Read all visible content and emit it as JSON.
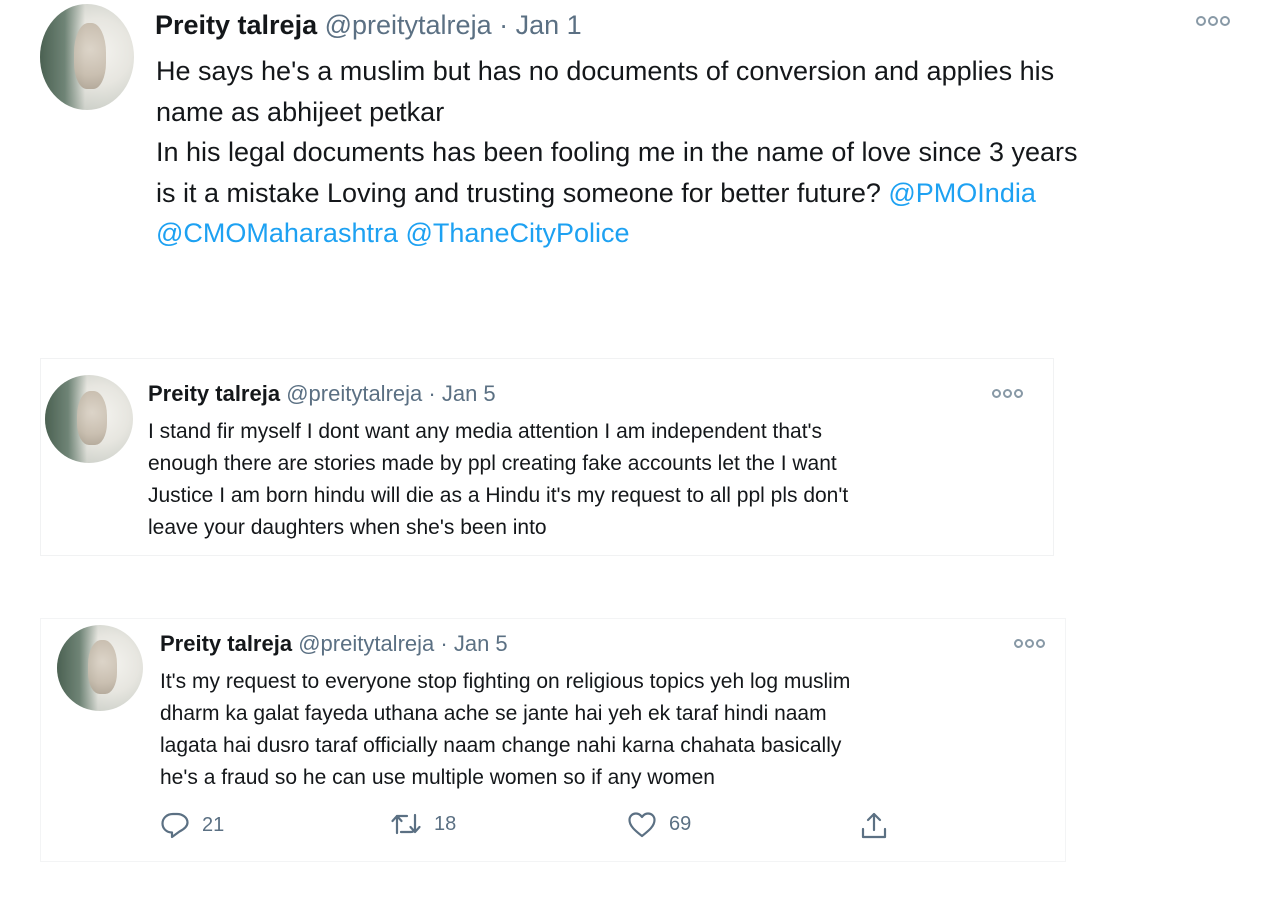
{
  "tweets": [
    {
      "name": "Preity talreja",
      "handle": "@preitytalreja",
      "separator": "·",
      "date": "Jan 1",
      "lines": [
        [
          {
            "text": "He says he's a muslim but has no documents of conversion and applies his"
          }
        ],
        [
          {
            "text": "name as abhijeet petkar"
          }
        ],
        [
          {
            "text": "In his legal documents has been fooling me in the name of love since 3 years"
          }
        ],
        [
          {
            "text": "is it a mistake Loving and trusting someone for better future? "
          },
          {
            "text": "@PMOIndia",
            "mention": true
          }
        ],
        [
          {
            "text": "@CMOMaharashtra",
            "mention": true
          },
          {
            "text": " "
          },
          {
            "text": "@ThaneCityPolice",
            "mention": true
          }
        ]
      ]
    },
    {
      "name": "Preity talreja",
      "handle": "@preitytalreja",
      "separator": "·",
      "date": "Jan 5",
      "lines": [
        [
          {
            "text": "I stand fir myself I dont want any media attention I am independent that's"
          }
        ],
        [
          {
            "text": "enough there are stories made by ppl creating fake accounts let the I want"
          }
        ],
        [
          {
            "text": "Justice I am born hindu will die as a Hindu it's my request to all ppl pls don't"
          }
        ],
        [
          {
            "text": "leave your daughters when she's been into"
          }
        ]
      ]
    },
    {
      "name": "Preity talreja",
      "handle": "@preitytalreja",
      "separator": "·",
      "date": "Jan 5",
      "lines": [
        [
          {
            "text": "It's my request to everyone stop fighting on religious topics yeh log muslim"
          }
        ],
        [
          {
            "text": "dharm ka galat fayeda uthana ache se jante hai yeh ek taraf hindi naam"
          }
        ],
        [
          {
            "text": "lagata hai dusro taraf officially naam change nahi karna chahata basically"
          }
        ],
        [
          {
            "text": "he's a fraud so he can use multiple women so if any women"
          }
        ]
      ],
      "actions": {
        "replies": "21",
        "retweets": "18",
        "likes": "69"
      }
    }
  ],
  "icons": {
    "more": "more-options-icon",
    "reply": "reply-icon",
    "retweet": "retweet-icon",
    "like": "heart-icon",
    "share": "share-icon"
  },
  "colors": {
    "text": "#14171a",
    "secondary": "#5b7083",
    "mention": "#1da1f2"
  }
}
